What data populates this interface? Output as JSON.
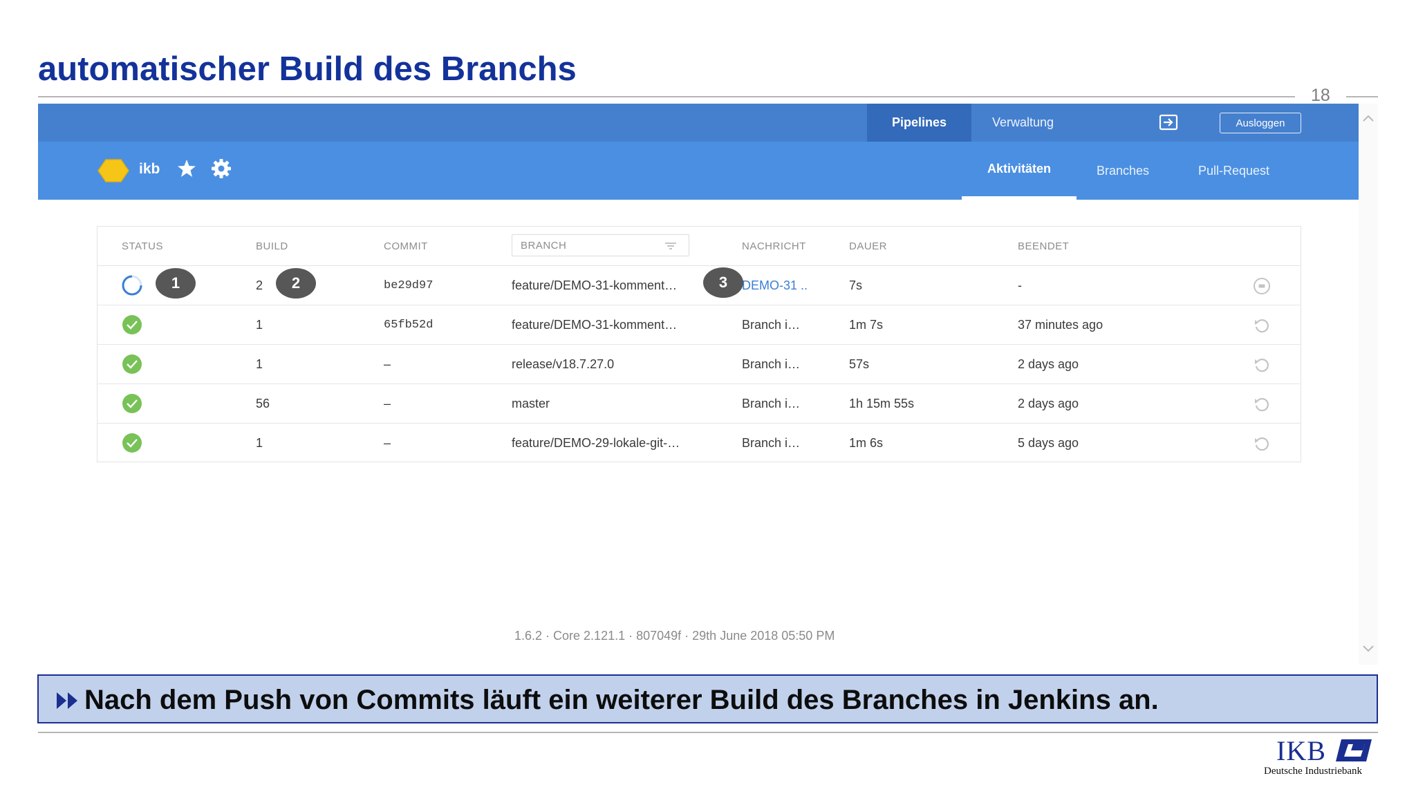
{
  "slide": {
    "title": "automatischer Build des Branchs",
    "page_number": "18"
  },
  "app": {
    "topnav": {
      "pipelines": "Pipelines",
      "verwaltung": "Verwaltung",
      "logout": "Ausloggen"
    },
    "org": {
      "name": "ikb"
    },
    "tabs": {
      "aktivitaeten": "Aktivitäten",
      "branches": "Branches",
      "pull_request": "Pull-Request"
    },
    "table": {
      "headers": {
        "status": "STATUS",
        "build": "BUILD",
        "commit": "COMMIT",
        "branch": "BRANCH",
        "nachricht": "NACHRICHT",
        "dauer": "DAUER",
        "beendet": "BEENDET"
      },
      "rows": [
        {
          "status": "running",
          "build": "2",
          "commit": "be29d97",
          "branch": "feature/DEMO-31-komment…",
          "nachricht": "DEMO-31 ..",
          "dauer": "7s",
          "beendet": "-",
          "action": "stop"
        },
        {
          "status": "success",
          "build": "1",
          "commit": "65fb52d",
          "branch": "feature/DEMO-31-komment…",
          "nachricht": "Branch i…",
          "dauer": "1m 7s",
          "beendet": "37 minutes ago",
          "action": "rerun"
        },
        {
          "status": "success",
          "build": "1",
          "commit": "–",
          "branch": "release/v18.7.27.0",
          "nachricht": "Branch i…",
          "dauer": "57s",
          "beendet": "2 days ago",
          "action": "rerun"
        },
        {
          "status": "success",
          "build": "56",
          "commit": "–",
          "branch": "master",
          "nachricht": "Branch i…",
          "dauer": "1h 15m 55s",
          "beendet": "2 days ago",
          "action": "rerun"
        },
        {
          "status": "success",
          "build": "1",
          "commit": "–",
          "branch": "feature/DEMO-29-lokale-git-…",
          "nachricht": "Branch i…",
          "dauer": "1m 6s",
          "beendet": "5 days ago",
          "action": "rerun"
        }
      ]
    },
    "callouts": [
      "1",
      "2",
      "3"
    ],
    "footer_version": "1.6.2 · Core 2.121.1 · 807049f · 29th June 2018 05:50 PM"
  },
  "note": "Nach dem Push von Commits läuft ein weiterer Build des Branches in Jenkins an.",
  "logo": {
    "text": "IKB",
    "subtitle": "Deutsche Industriebank"
  },
  "colors": {
    "title": "#13329a",
    "topbar": "#4580cf",
    "subbar": "#4a8fe2",
    "success": "#78c257",
    "note_bg": "#c1d1ec",
    "note_border": "#1a2f8f"
  },
  "icons": {
    "status_running": "spinner-ring-icon",
    "status_success": "check-circle-icon",
    "action_stop": "stop-circle-icon",
    "action_rerun": "replay-icon"
  }
}
